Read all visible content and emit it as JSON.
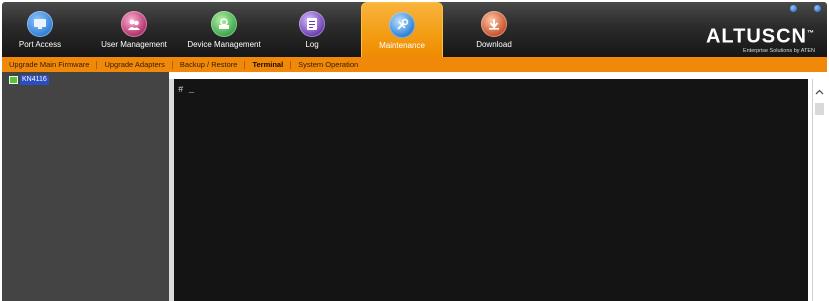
{
  "nav": {
    "tabs": [
      {
        "label": "Port Access",
        "icon": "monitor-icon",
        "color": "#2f7fd6",
        "active": false
      },
      {
        "label": "User Management",
        "icon": "users-icon",
        "color": "#b0306a",
        "active": false
      },
      {
        "label": "Device Management",
        "icon": "device-icon",
        "color": "#3aa64a",
        "active": false
      },
      {
        "label": "Log",
        "icon": "log-icon",
        "color": "#6a3bb0",
        "active": false
      },
      {
        "label": "Maintenance",
        "icon": "tools-icon",
        "color": "#2a7fd4",
        "active": true
      },
      {
        "label": "Download",
        "icon": "download-icon",
        "color": "#c8502a",
        "active": false
      }
    ]
  },
  "brand": {
    "name": "ALTUSCN",
    "tm": "™",
    "tagline": "Enterprise Solutions by ATEN"
  },
  "submenu": {
    "items": [
      {
        "label": "Upgrade Main Firmware",
        "active": false
      },
      {
        "label": "Upgrade Adapters",
        "active": false
      },
      {
        "label": "Backup / Restore",
        "active": false
      },
      {
        "label": "Terminal",
        "active": true
      },
      {
        "label": "System Operation",
        "active": false
      }
    ]
  },
  "sidebar": {
    "device": "KN4116"
  },
  "terminal": {
    "prompt": "# _"
  },
  "colors": {
    "accent": "#f39c12",
    "submenu_bg": "#f0890a",
    "sidebar_bg": "#444444",
    "terminal_bg": "#141414"
  }
}
